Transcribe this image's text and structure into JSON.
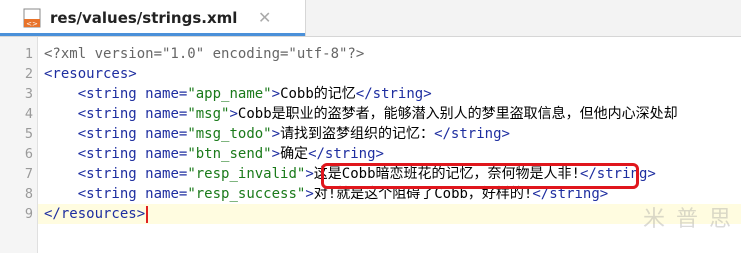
{
  "tab": {
    "title": "res/values/strings.xml",
    "icon": "xml-file-icon",
    "close": "✕"
  },
  "line_numbers": [
    "1",
    "2",
    "3",
    "4",
    "5",
    "6",
    "7",
    "8",
    "9"
  ],
  "code": {
    "l1": "<?xml version=\"1.0\" encoding=\"utf-8\"?>",
    "l2_open": "<resources>",
    "tag_string_open": "<string",
    "attr_name": "name=",
    "close_bracket": ">",
    "tag_string_close": "</string>",
    "l3_name": "\"app_name\"",
    "l3_text": "Cobb的记忆",
    "l4_name": "\"msg\"",
    "l4_text": "Cobb是职业的盗梦者，能够潜入别人的梦里盗取信息，但他内心深处却",
    "l5_name": "\"msg_todo\"",
    "l5_text": "请找到盗梦组织的记忆：",
    "l6_name": "\"btn_send\"",
    "l6_text": "确定",
    "l7_name": "\"resp_invalid\"",
    "l7_text": "这是Cobb暗恋班花的记忆，奈何物是人非!",
    "l8_name": "\"resp_success\"",
    "l8_text": "对!就是这个阻碍了Cobb，好样的!",
    "l9_close": "</resources>"
  },
  "watermark": "米 普 思"
}
